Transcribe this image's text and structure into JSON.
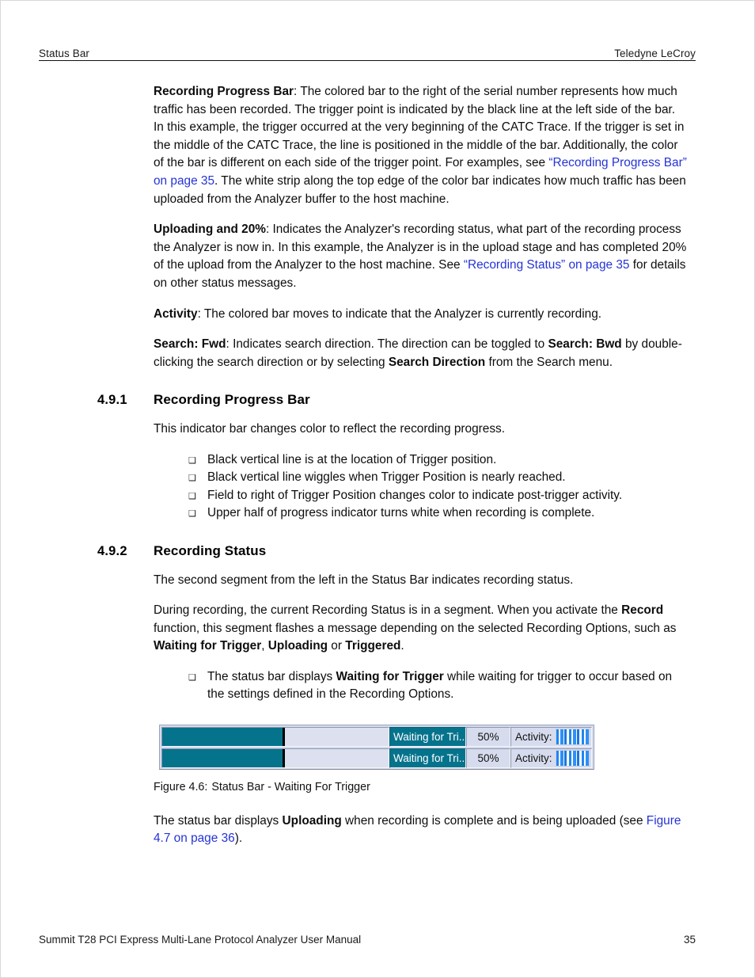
{
  "header": {
    "left": "Status Bar",
    "right": "Teledyne LeCroy"
  },
  "footer": {
    "left": "Summit T28 PCI Express Multi-Lane Protocol Analyzer User Manual",
    "page_number": "35"
  },
  "paragraphs": {
    "p1": {
      "lead": "Recording Progress Bar",
      "t1": ": The colored bar to the right of the serial number represents how much traffic has been recorded. The trigger point is indicated by the black line at the left side of the bar. In this example, the trigger occurred at the very beginning of the CATC Trace. If the trigger is set in the middle of the CATC Trace, the line is positioned in the middle of the bar. Additionally, the color of the bar is different on each side of the trigger point. For examples, see ",
      "link": "“Recording Progress Bar” on page 35",
      "t2": ". The white strip along the top edge of the color bar indicates how much traffic has been uploaded from the Analyzer buffer to the host machine."
    },
    "p2": {
      "lead": "Uploading and 20%",
      "t1": ": Indicates the Analyzer's recording status, what part of the recording process the Analyzer is now in. In this example, the Analyzer is in the upload stage and has completed 20% of the upload from the Analyzer to the host machine. See ",
      "link": "“Recording Status” on page 35",
      "t2": " for details on other status messages."
    },
    "p3": {
      "lead": "Activity",
      "t1": ": The colored bar moves to indicate that the Analyzer is currently recording."
    },
    "p4": {
      "lead": "Search: Fwd",
      "t1": ": Indicates search direction. The direction can be toggled to ",
      "bold1": "Search: Bwd",
      "t2": " by double-clicking the search direction or by selecting ",
      "bold2": "Search Direction",
      "t3": " from the Search menu."
    }
  },
  "section_491": {
    "number": "4.9.1",
    "title": "Recording Progress Bar",
    "intro": "This indicator bar changes color to reflect the recording progress.",
    "bullets": [
      "Black vertical line is at the location of Trigger position.",
      "Black vertical line wiggles when Trigger Position is nearly reached.",
      "Field to right of Trigger Position changes color to indicate post-trigger activity.",
      "Upper half of progress indicator turns white when recording is complete."
    ]
  },
  "section_492": {
    "number": "4.9.2",
    "title": "Recording Status",
    "intro": "The second segment from the left in the Status Bar indicates recording status.",
    "para": {
      "t1": "During recording, the current Recording Status is in a segment. When you activate the ",
      "bold1": "Record",
      "t2": " function, this segment flashes a message depending on the selected Recording Options, such as ",
      "bold2": "Waiting for Trigger",
      "t3": ", ",
      "bold3": "Uploading",
      "t4": " or ",
      "bold4": "Triggered",
      "t5": "."
    },
    "bullet": {
      "t1": "The status bar displays ",
      "bold1": "Waiting for Trigger",
      "t2": " while waiting for trigger to occur based on the settings defined in the Recording Options."
    },
    "closing": {
      "t1": "The status bar displays ",
      "bold1": "Uploading",
      "t2": " when recording is complete and is being uploaded (see ",
      "link": "Figure 4.7 on page 36",
      "t3": ")."
    }
  },
  "figure": {
    "caption_number": "Figure 4.6:",
    "caption_text": "Status Bar - Waiting For Trigger",
    "colors": {
      "progress_fill": "#06738c",
      "progress_track": "#dde1ef",
      "trigger_line": "#000000",
      "status_bg": "#06738c",
      "panel_bg": "#d6dced",
      "activity_stripe": "#1f86f0"
    },
    "rows": [
      {
        "progress_percent": "53",
        "status_label": "Waiting for Tri...",
        "percent_label": "50%",
        "activity_label": "Activity:"
      },
      {
        "progress_percent": "53",
        "status_label": "Waiting for Tri...",
        "percent_label": "50%",
        "activity_label": "Activity:"
      }
    ]
  }
}
